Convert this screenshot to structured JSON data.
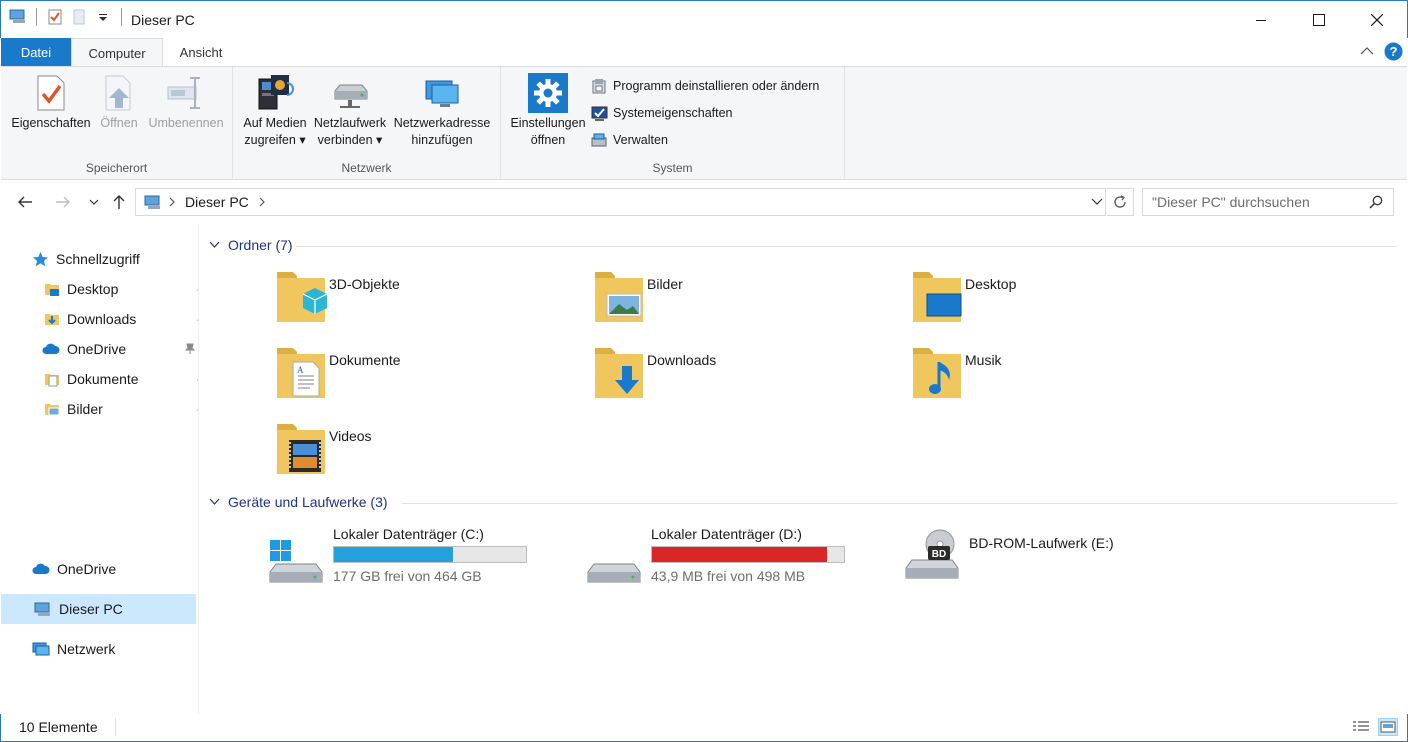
{
  "window": {
    "title": "Dieser PC"
  },
  "ribbon": {
    "tabs": {
      "file": "Datei",
      "computer": "Computer",
      "view": "Ansicht"
    },
    "groups": {
      "location": {
        "label": "Speicherort",
        "properties": "Eigenschaften",
        "open": "Öffnen",
        "rename": "Umbenennen"
      },
      "network": {
        "label": "Netzwerk",
        "media_line1": "Auf Medien",
        "media_line2": "zugreifen",
        "map_line1": "Netzlaufwerk",
        "map_line2": "verbinden",
        "add_line1": "Netzwerkadresse",
        "add_line2": "hinzufügen"
      },
      "system": {
        "label": "System",
        "settings_line1": "Einstellungen",
        "settings_line2": "öffnen",
        "uninstall": "Programm deinstallieren oder ändern",
        "properties": "Systemeigenschaften",
        "manage": "Verwalten"
      }
    }
  },
  "address": {
    "path": "Dieser PC",
    "search_placeholder": "\"Dieser PC\" durchsuchen"
  },
  "navpane": {
    "quick_access": "Schnellzugriff",
    "pinned": [
      {
        "label": "Desktop",
        "icon": "desktop-folder-icon"
      },
      {
        "label": "Downloads",
        "icon": "downloads-folder-icon"
      },
      {
        "label": "OneDrive",
        "icon": "onedrive-icon"
      },
      {
        "label": "Dokumente",
        "icon": "documents-folder-icon"
      },
      {
        "label": "Bilder",
        "icon": "pictures-folder-icon"
      }
    ],
    "onedrive": "OneDrive",
    "this_pc": "Dieser PC",
    "network": "Netzwerk"
  },
  "content": {
    "folders_header": "Ordner (7)",
    "folders": [
      {
        "label": "3D-Objekte",
        "icon": "3d-objects-folder-icon"
      },
      {
        "label": "Bilder",
        "icon": "pictures-folder-icon"
      },
      {
        "label": "Desktop",
        "icon": "desktop-folder-icon"
      },
      {
        "label": "Dokumente",
        "icon": "documents-folder-icon"
      },
      {
        "label": "Downloads",
        "icon": "downloads-folder-icon"
      },
      {
        "label": "Musik",
        "icon": "music-folder-icon"
      },
      {
        "label": "Videos",
        "icon": "videos-folder-icon"
      }
    ],
    "drives_header": "Geräte und Laufwerke (3)",
    "drives": [
      {
        "name": "Lokaler Datenträger (C:)",
        "free": "177 GB frei von 464 GB",
        "used_fraction": 0.62,
        "bar_color": "#26a0da"
      },
      {
        "name": "Lokaler Datenträger (D:)",
        "free": "43,9 MB frei von 498 MB",
        "used_fraction": 0.91,
        "bar_color": "#da2626"
      },
      {
        "name": "BD-ROM-Laufwerk (E:)"
      }
    ]
  },
  "status": {
    "count": "10 Elemente"
  },
  "colors": {
    "accent": "#1979ca",
    "folder": "#f0c75e",
    "selected": "#cce8ff"
  }
}
